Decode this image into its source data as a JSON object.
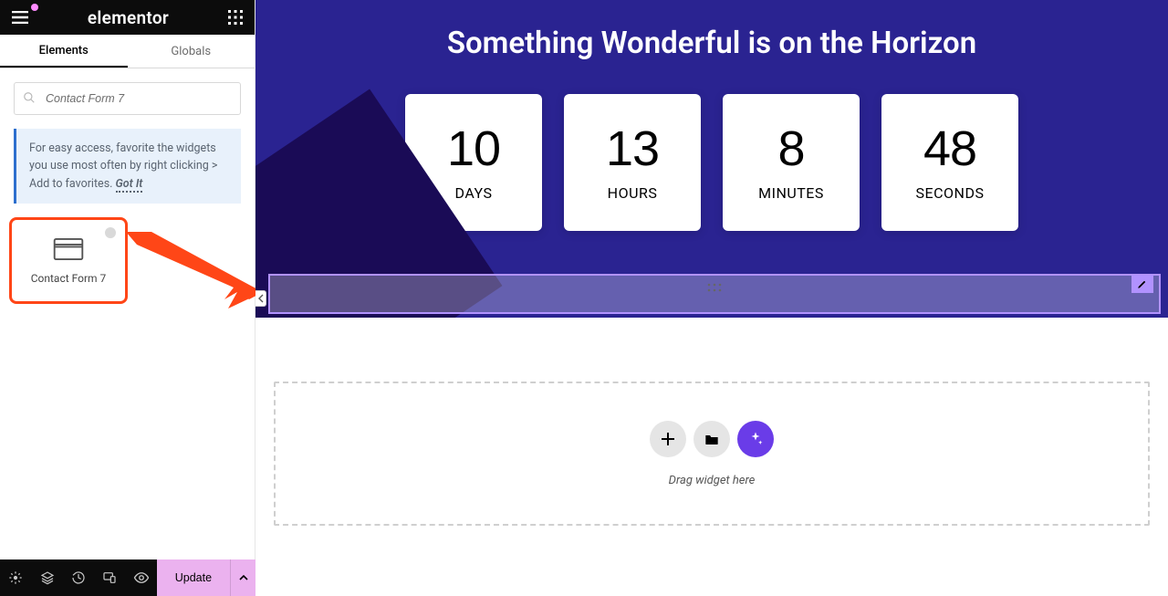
{
  "header": {
    "brand": "elementor"
  },
  "tabs": {
    "elements": "Elements",
    "globals": "Globals"
  },
  "search": {
    "value": "Contact Form 7"
  },
  "tip": {
    "text": "For easy access, favorite the widgets you use most often by right clicking > Add to favorites.",
    "link": "Got It"
  },
  "widget": {
    "cf7": "Contact Form 7"
  },
  "footer": {
    "update": "Update"
  },
  "hero": {
    "title": "Something Wonderful is on the Horizon"
  },
  "countdown": {
    "days_n": "10",
    "days_l": "DAYS",
    "hours_n": "13",
    "hours_l": "HOURS",
    "minutes_n": "8",
    "minutes_l": "MINUTES",
    "seconds_n": "48",
    "seconds_l": "SECONDS"
  },
  "new_section": {
    "label": "Drag widget here"
  }
}
